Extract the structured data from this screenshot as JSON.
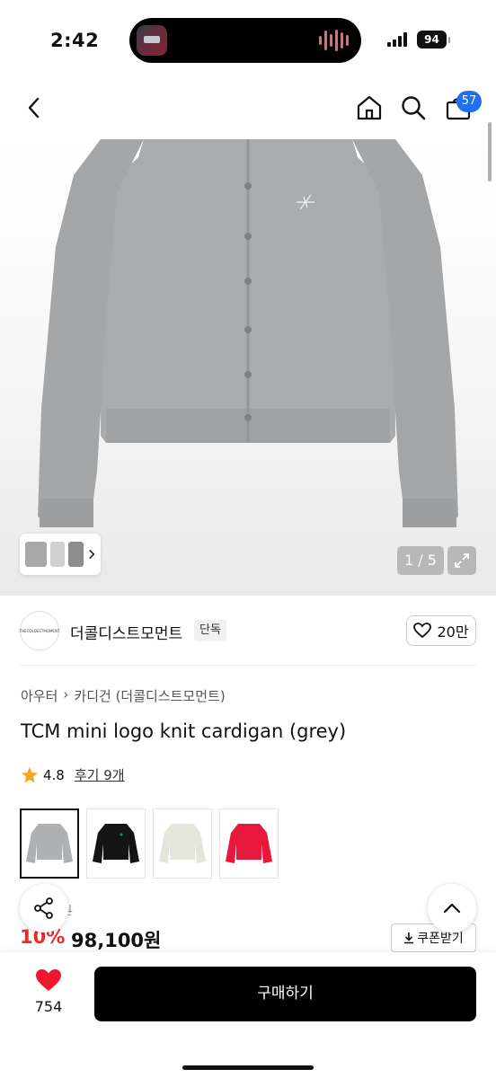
{
  "status": {
    "time": "2:42",
    "battery": "94"
  },
  "nav": {
    "cart_count": "57"
  },
  "gallery": {
    "counter": "1 / 5"
  },
  "brand": {
    "logo_text": "THECOLDESTMOMENT",
    "name": "더콜디스트모먼트",
    "exclusive_badge": "단독",
    "likes": "20만"
  },
  "breadcrumb": {
    "level1": "아우터",
    "level2": "카디건 (더콜디스트모먼트)"
  },
  "product": {
    "title": "TCM mini logo knit cardigan (grey)",
    "rating": "4.8",
    "reviews": "후기 9개"
  },
  "colors": [
    {
      "name": "grey",
      "hex": "#aeb0b2"
    },
    {
      "name": "black",
      "hex": "#141414"
    },
    {
      "name": "ivory",
      "hex": "#e4e6dc"
    },
    {
      "name": "red",
      "hex": "#e8173c"
    }
  ],
  "price": {
    "original_partial": "0원",
    "discount": "10%",
    "sale": "98,100원",
    "coupon_label": "쿠폰받기"
  },
  "bottom": {
    "wish_count": "754",
    "buy_label": "구매하기"
  },
  "accent": {
    "brand_blue": "#1e6ff1",
    "discount_red": "#f02a2a",
    "heart_red": "#f0162e",
    "star": "#f5a623"
  }
}
